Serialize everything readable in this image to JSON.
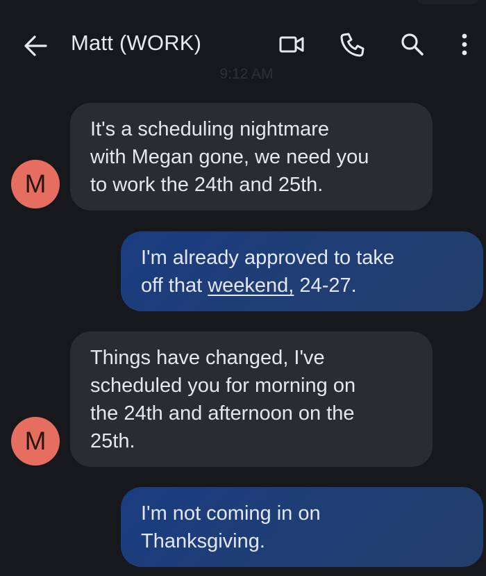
{
  "header": {
    "back_icon": "arrow-left-icon",
    "contact_name": "Matt (WORK)",
    "video_icon": "video-camera-icon",
    "call_icon": "phone-icon",
    "search_icon": "search-icon",
    "more_icon": "more-vertical-icon"
  },
  "conversation": {
    "timestamp": "9:12 AM",
    "messages": [
      {
        "direction": "incoming",
        "avatar_letter": "M",
        "lines": [
          "It's a scheduling nightmare",
          "with Megan gone, we need you",
          "to work the 24th and 25th."
        ]
      },
      {
        "direction": "outgoing",
        "line1": "I'm already approved to take",
        "line2_prefix": "off that ",
        "line2_link": "weekend,",
        "line2_suffix": " 24-27."
      },
      {
        "direction": "incoming",
        "avatar_letter": "M",
        "lines": [
          "Things have changed, I've",
          "scheduled you for morning on",
          "the 24th and afternoon on the",
          "25th."
        ]
      },
      {
        "direction": "outgoing",
        "lines": [
          "I'm not coming in on",
          "Thanksgiving."
        ]
      }
    ]
  },
  "colors": {
    "background": "#17181c",
    "incoming_bubble": "#2b2c31",
    "outgoing_bubble": "#1b3d80",
    "avatar": "#e66e60"
  }
}
